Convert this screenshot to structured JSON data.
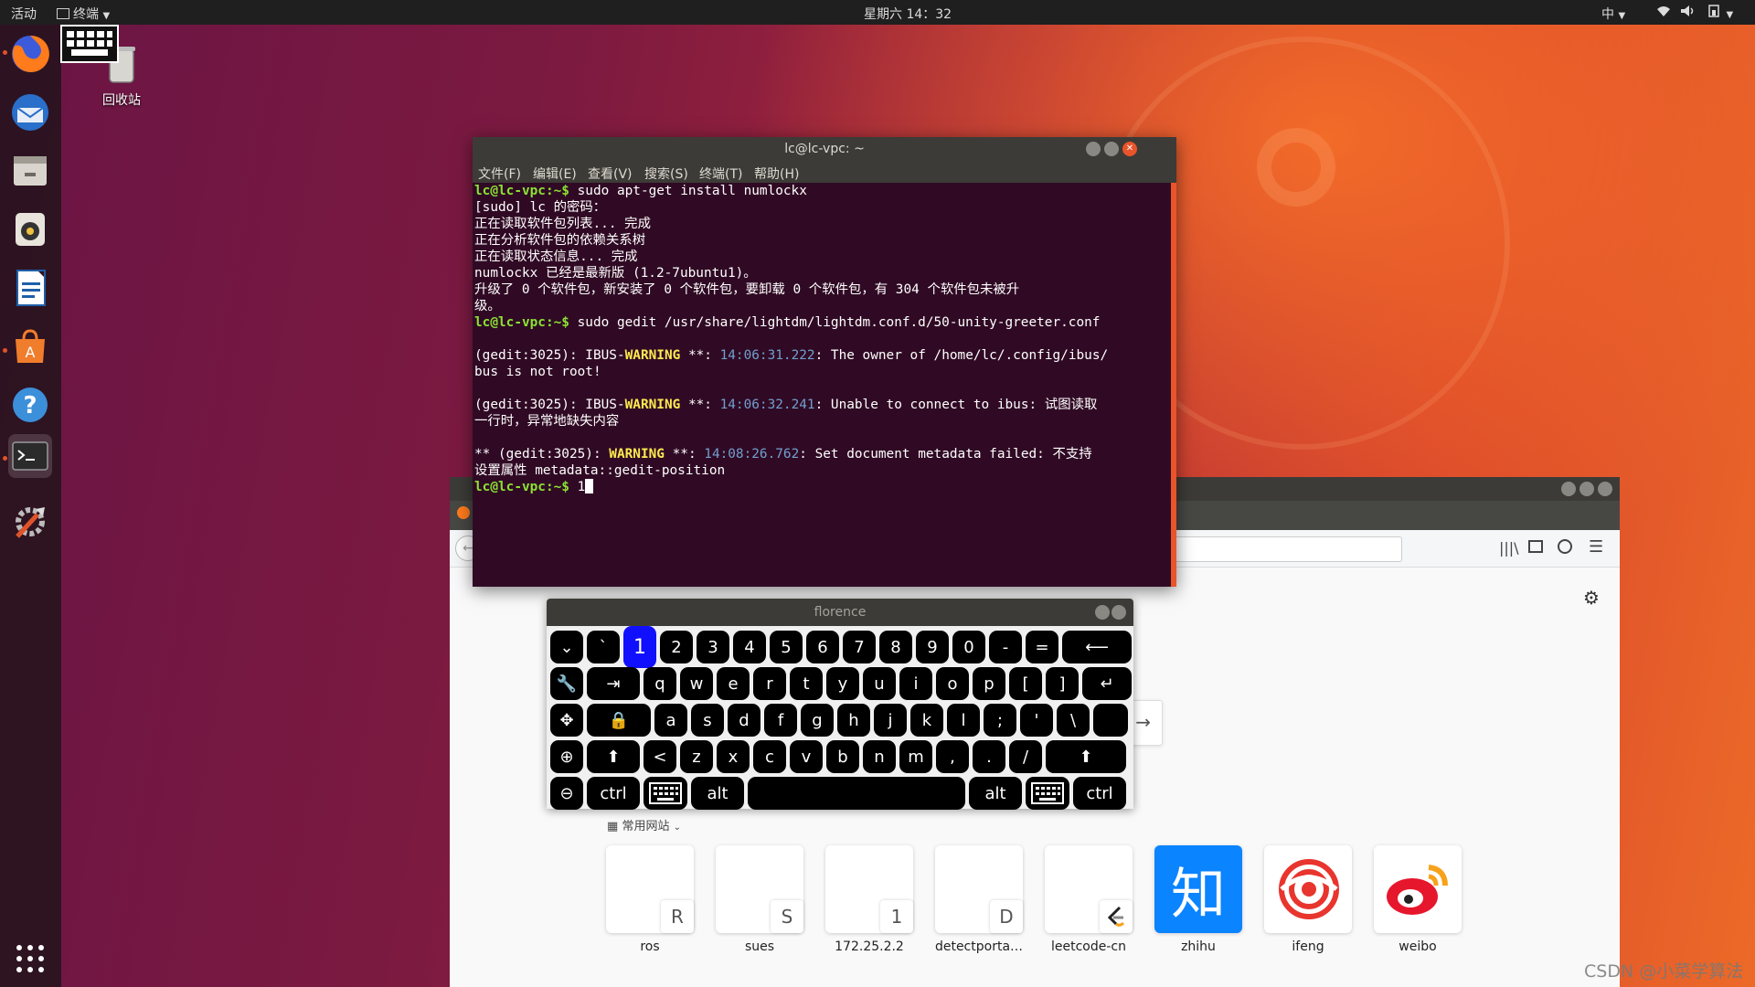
{
  "topbar": {
    "activities": "活动",
    "app_menu": "终端",
    "clock": "星期六 14：32",
    "input_method": "中"
  },
  "desktop": {
    "trash_label": "回收站"
  },
  "terminal": {
    "title": "lc@lc-vpc: ~",
    "menu": [
      "文件(F)",
      "编辑(E)",
      "查看(V)",
      "搜索(S)",
      "终端(T)",
      "帮助(H)"
    ],
    "prompt": "lc@lc-vpc:~$",
    "cmd1": " sudo apt-get install numlockx",
    "out1": "[sudo] lc 的密码：",
    "out2": "正在读取软件包列表... 完成",
    "out3": "正在分析软件包的依赖关系树",
    "out4": "正在读取状态信息... 完成",
    "out5": "numlockx 已经是最新版 (1.2-7ubuntu1)。",
    "out6a": "升级了 0 个软件包，新安装了 0 个软件包，要卸载 0 个软件包，有 304 个软件包未被升",
    "out6b": "级。",
    "cmd2": " sudo gedit /usr/share/lightdm/lightdm.conf.d/50-unity-greeter.conf",
    "w1_pre": "(gedit:3025): IBUS-",
    "warning": "WARNING",
    "stars": " **: ",
    "w1_ts": "14:06:31.222",
    "w1_msg": ": The owner of /home/lc/.config/ibus/",
    "w1_cont": "bus is not root!",
    "w2_pre": "(gedit:3025): IBUS-",
    "w2_ts": "14:06:32.241",
    "w2_msg": ": Unable to connect to ibus: 试图读取",
    "w2_cont": "一行时，异常地缺失内容",
    "w3_pre": "** (gedit:3025): ",
    "w3_ts": "14:08:26.762",
    "w3_msg": ": Set document metadata failed: 不支持",
    "w3_cont": "设置属性 metadata::gedit-position",
    "cmd3": " 1"
  },
  "florence": {
    "title": "florence",
    "row1": [
      "`",
      "1",
      "2",
      "3",
      "4",
      "5",
      "6",
      "7",
      "8",
      "9",
      "0",
      "-",
      "="
    ],
    "row2": [
      "q",
      "w",
      "e",
      "r",
      "t",
      "y",
      "u",
      "i",
      "o",
      "p",
      "[",
      "]"
    ],
    "row3": [
      "a",
      "s",
      "d",
      "f",
      "g",
      "h",
      "j",
      "k",
      "l",
      ";",
      "'",
      "\\"
    ],
    "row4": [
      "<",
      "z",
      "x",
      "c",
      "v",
      "b",
      "n",
      "m",
      ",",
      ".",
      "/"
    ],
    "ctrl": "ctrl",
    "alt": "alt",
    "pressed_key": "1"
  },
  "firefox": {
    "top_sites_label": "常用网站",
    "tiles": [
      {
        "label": "ros",
        "badge": "R"
      },
      {
        "label": "sues",
        "badge": "S"
      },
      {
        "label": "172.25.2.2",
        "badge": "1"
      },
      {
        "label": "detectporta…",
        "badge": "D"
      },
      {
        "label": "leetcode-cn",
        "badge": ""
      },
      {
        "label": "zhihu",
        "badge": "知"
      },
      {
        "label": "ifeng",
        "badge": ""
      },
      {
        "label": "weibo",
        "badge": ""
      }
    ]
  },
  "watermark": "CSDN @小菜学算法",
  "colors": {
    "ubuntu_orange": "#e9542a",
    "terminal_bg": "#300a24",
    "prompt_green": "#8ae234",
    "warning_yellow": "#fce94f",
    "timestamp_blue": "#729fcf",
    "pressed_key_blue": "#1010ff"
  }
}
